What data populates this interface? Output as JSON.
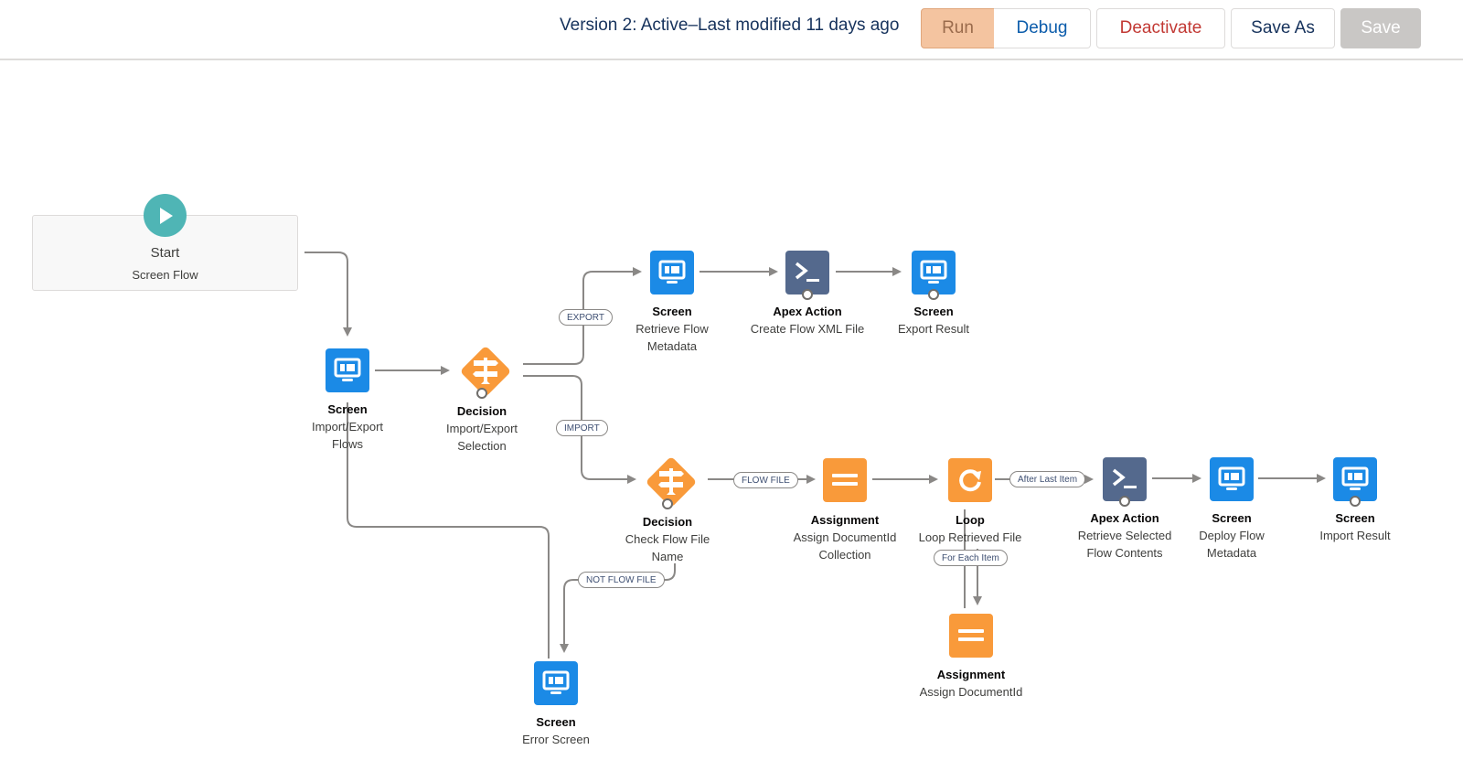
{
  "header": {
    "version_status": "Version 2: Active–Last modified 11 days ago",
    "buttons": {
      "run": "Run",
      "debug": "Debug",
      "deactivate": "Deactivate",
      "save_as": "Save As",
      "save": "Save"
    }
  },
  "colors": {
    "screen": "#1b8ae6",
    "apex": "#54698d",
    "logic": "#f99a3a",
    "start": "#4fb5b5",
    "connector": "#8a8886"
  },
  "start": {
    "title": "Start",
    "subtitle": "Screen Flow",
    "icon": "play-icon"
  },
  "nodes": [
    {
      "id": "screen-import-export",
      "type": "Screen",
      "label": "Import/Export Flows",
      "icon": "monitor-icon"
    },
    {
      "id": "decision-import-export",
      "type": "Decision",
      "label": "Import/Export Selection",
      "icon": "signpost-icon"
    },
    {
      "id": "screen-retrieve-flow",
      "type": "Screen",
      "label": "Retrieve Flow Metadata",
      "icon": "monitor-icon"
    },
    {
      "id": "apex-create-xml",
      "type": "Apex Action",
      "label": "Create Flow XML File",
      "icon": "terminal-icon"
    },
    {
      "id": "screen-export-result",
      "type": "Screen",
      "label": "Export Result",
      "icon": "monitor-icon"
    },
    {
      "id": "decision-check-file",
      "type": "Decision",
      "label": "Check Flow File Name",
      "icon": "signpost-icon"
    },
    {
      "id": "assign-collection",
      "type": "Assignment",
      "label": "Assign DocumentId Collection",
      "icon": "equals-icon"
    },
    {
      "id": "loop-retrieved",
      "type": "Loop",
      "label": "Loop Retrieved File",
      "icon": "loop-icon"
    },
    {
      "id": "apex-retrieve-contents",
      "type": "Apex Action",
      "label": "Retrieve Selected Flow Contents",
      "icon": "terminal-icon"
    },
    {
      "id": "screen-deploy",
      "type": "Screen",
      "label": "Deploy Flow Metadata",
      "icon": "monitor-icon"
    },
    {
      "id": "screen-import-result",
      "type": "Screen",
      "label": "Import Result",
      "icon": "monitor-icon"
    },
    {
      "id": "assign-documentid",
      "type": "Assignment",
      "label": "Assign DocumentId",
      "icon": "equals-icon"
    },
    {
      "id": "screen-error",
      "type": "Screen",
      "label": "Error Screen",
      "icon": "monitor-icon"
    }
  ],
  "connector_labels": {
    "export": "EXPORT",
    "import": "IMPORT",
    "flow_file": "FLOW FILE",
    "not_flow_file": "NOT FLOW FILE",
    "after_last_item": "After Last Item",
    "for_each_item": "For Each Item"
  }
}
